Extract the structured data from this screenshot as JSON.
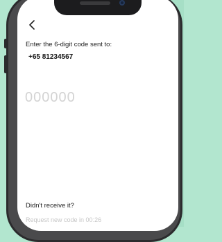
{
  "colors": {
    "background": "#b2e6cf",
    "screen": "#ffffff",
    "placeholder": "#d3d3d3",
    "muted_text": "#c6c6c6"
  },
  "icons": {
    "back": "chevron-left-icon"
  },
  "verify": {
    "prompt": "Enter the 6-digit code sent to:",
    "phone_number": "+65 81234567",
    "code_placeholder": "000000",
    "code_value": ""
  },
  "resend": {
    "question": "Didn't receive it?",
    "request_label": "Request new code in 00:26"
  }
}
